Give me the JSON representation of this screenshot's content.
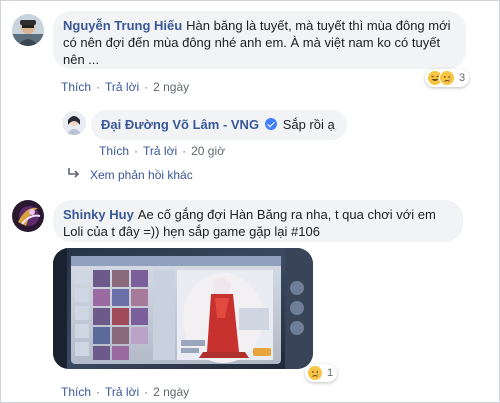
{
  "comments": [
    {
      "author": "Nguyễn Trung Hiếu",
      "text": "Hàn băng là tuyết, mà tuyết thì mùa đông mới có nên đợi đến mùa đông nhé anh em. À mà việt nam ko có tuyết nên ...",
      "like_label": "Thích",
      "reply_label": "Trả lời",
      "time": "2 ngày",
      "reaction_count": "3",
      "reaction_icons": [
        "laugh-emoji",
        "sad-emoji"
      ]
    },
    {
      "author": "Shinky Huy",
      "text": "Ae cố gắng đợi Hàn Băng ra nha, t qua chơi với em Loli của t đây =)) hẹn sắp game gặp lại #106",
      "like_label": "Thích",
      "reply_label": "Trả lời",
      "time": "2 ngày",
      "reaction_count": "1",
      "reaction_icons": [
        "sad-emoji"
      ]
    }
  ],
  "reply": {
    "author": "Đại Đường Võ Lâm - VNG",
    "text": "Sắp rồi ạ",
    "like_label": "Thích",
    "reply_label": "Trả lời",
    "time": "20 giờ"
  },
  "more_replies_label": "Xem phản hồi khác",
  "colors": {
    "link": "#385898",
    "bubble": "#f2f3f5",
    "meta": "#606770",
    "verified": "#4080ff"
  }
}
